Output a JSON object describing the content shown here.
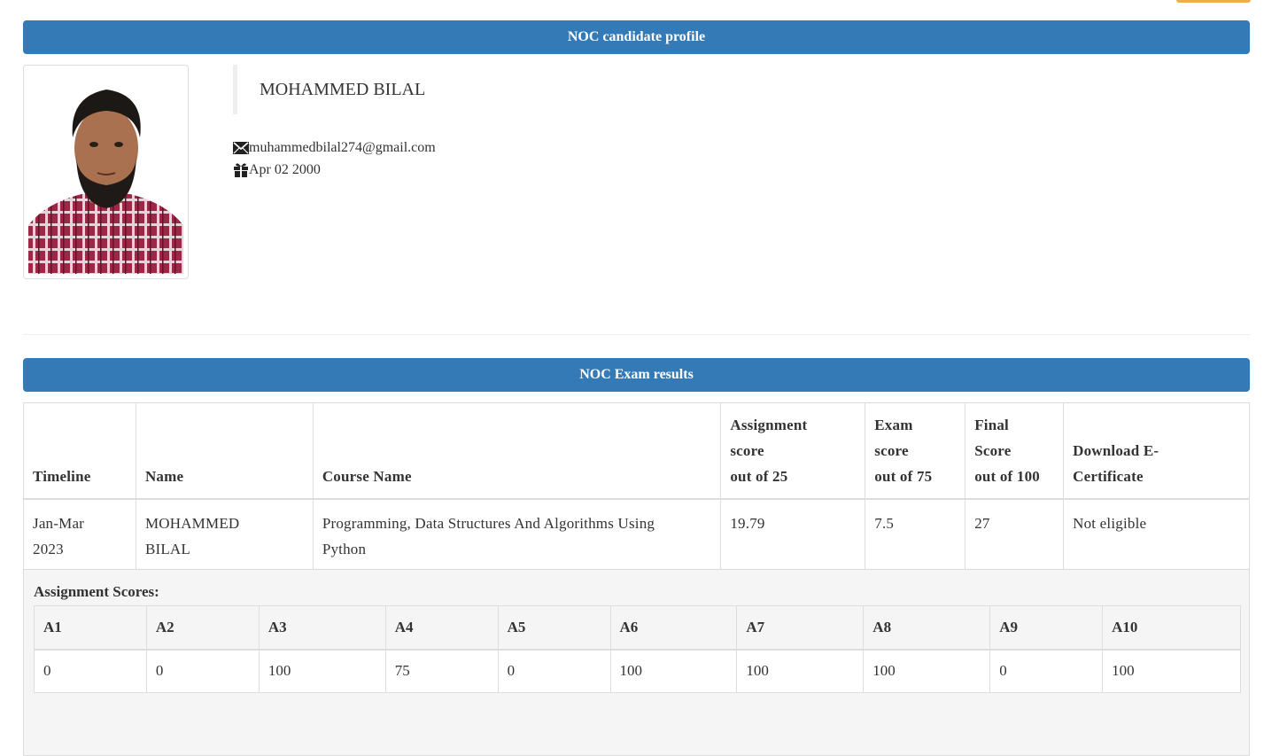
{
  "profile": {
    "header": "NOC candidate profile",
    "name": "MOHAMMED BILAL",
    "email": "muhammedbilal274@gmail.com",
    "dob": "Apr 02 2000"
  },
  "results": {
    "header": "NOC Exam results",
    "columns": {
      "timeline": "Timeline",
      "name": "Name",
      "course": "Course Name",
      "assignment_l1": "Assignment",
      "assignment_l2": "score",
      "assignment_l3": "out of 25",
      "exam_l1": "Exam",
      "exam_l2": "score",
      "exam_l3": "out of 75",
      "final_l1": "Final",
      "final_l2": "Score",
      "final_l3": "out of 100",
      "download_l1": "Download E-",
      "download_l2": "Certificate"
    },
    "row": {
      "timeline_l1": "Jan-Mar",
      "timeline_l2": "2023",
      "name_l1": "MOHAMMED",
      "name_l2": "BILAL",
      "course_l1": "Programming, Data Structures And Algorithms Using",
      "course_l2": "Python",
      "assignment": "19.79",
      "exam": "7.5",
      "final": "27",
      "download": "Not eligible"
    }
  },
  "assignments": {
    "title": "Assignment Scores:",
    "headers": [
      "A1",
      "A2",
      "A3",
      "A4",
      "A5",
      "A6",
      "A7",
      "A8",
      "A9",
      "A10"
    ],
    "scores": [
      "0",
      "0",
      "100",
      "75",
      "0",
      "100",
      "100",
      "100",
      "0",
      "100"
    ]
  },
  "icons": {
    "email": "envelope-icon",
    "dob": "gift-icon"
  },
  "colors": {
    "primary_bar": "#337ab7",
    "top_accent": "#f0ad4e"
  }
}
